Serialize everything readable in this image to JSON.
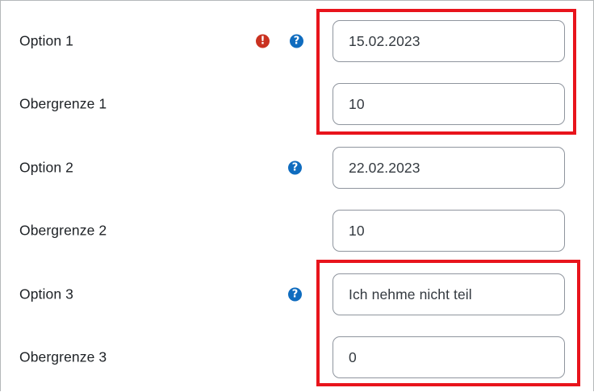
{
  "form": {
    "rows": [
      {
        "label": "Option 1",
        "value": "15.02.2023",
        "icons": [
          "error-icon",
          "help-icon"
        ]
      },
      {
        "label": "Obergrenze 1",
        "value": "10",
        "icons": []
      },
      {
        "label": "Option 2",
        "value": "22.02.2023",
        "icons": [
          "help-icon"
        ]
      },
      {
        "label": "Obergrenze 2",
        "value": "10",
        "icons": []
      },
      {
        "label": "Option 3",
        "value": "Ich nehme nicht teil",
        "icons": [
          "help-icon"
        ]
      },
      {
        "label": "Obergrenze 3",
        "value": "0",
        "icons": []
      }
    ]
  },
  "icons": {
    "error_glyph": "!",
    "help_glyph": "?"
  },
  "colors": {
    "error_icon": "#ca3120",
    "help_icon": "#0f6cbf",
    "highlight_border": "#e8141c",
    "field_border": "#8f959e"
  }
}
